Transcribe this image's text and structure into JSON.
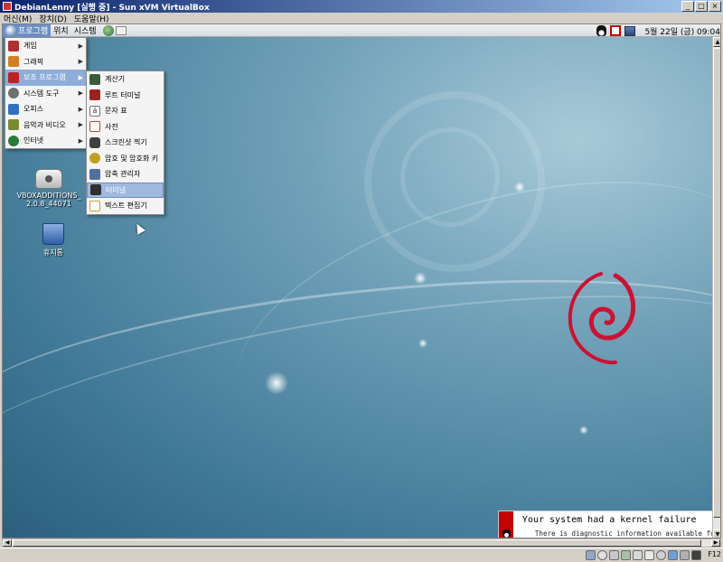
{
  "window": {
    "title": "DebianLenny [실행 중] - Sun xVM VirtualBox",
    "buttons": [
      "_",
      "□",
      "×"
    ]
  },
  "host_menu": [
    "머신(M)",
    "장치(D)",
    "도움말(H)"
  ],
  "gnome_panel": {
    "menus": [
      "프로그램",
      "위치",
      "시스템"
    ],
    "clock": "5월 22일 (금) 09:04"
  },
  "desktop_icons": [
    {
      "label": "VBOXADDITIONS_2.0.8_44071",
      "icon": "cdrom-icon"
    },
    {
      "label": "휴지통",
      "icon": "trash-icon"
    }
  ],
  "programs_menu": [
    {
      "label": "게임",
      "icon": "games-icon",
      "color": "#b03030"
    },
    {
      "label": "그래픽",
      "icon": "graphics-icon",
      "color": "#d08020"
    },
    {
      "label": "보조 프로그램",
      "icon": "accessories-icon",
      "color": "#c02020"
    },
    {
      "label": "시스템 도구",
      "icon": "system-tools-icon",
      "color": "#707070"
    },
    {
      "label": "오피스",
      "icon": "office-icon",
      "color": "#3070c0"
    },
    {
      "label": "음악과 비디오",
      "icon": "multimedia-icon",
      "color": "#7a8a30"
    },
    {
      "label": "인터넷",
      "icon": "internet-icon",
      "color": "#2a7a3a"
    }
  ],
  "accessories_menu": [
    {
      "label": "계산기",
      "icon": "calculator-icon",
      "color": "#3a5a3a"
    },
    {
      "label": "루트 터미널",
      "icon": "root-terminal-icon",
      "color": "#a02020"
    },
    {
      "label": "문자 표",
      "icon": "character-map-icon",
      "color": "#ffffff"
    },
    {
      "label": "사전",
      "icon": "dictionary-icon",
      "color": "#c04040"
    },
    {
      "label": "스크린샷 찍기",
      "icon": "screenshot-icon",
      "color": "#404040"
    },
    {
      "label": "암호 및 암호화 키",
      "icon": "keys-icon",
      "color": "#c0a020"
    },
    {
      "label": "압축 관리자",
      "icon": "archive-icon",
      "color": "#5070a0"
    },
    {
      "label": "터미널",
      "icon": "terminal-icon",
      "color": "#303030"
    },
    {
      "label": "텍스트 편집기",
      "icon": "text-editor-icon",
      "color": "#d0a030"
    }
  ],
  "notification": {
    "title": "Your system had a kernel failure",
    "body": "There is diagnostic information available for this"
  },
  "statusbar": {
    "host_key": "F12"
  }
}
